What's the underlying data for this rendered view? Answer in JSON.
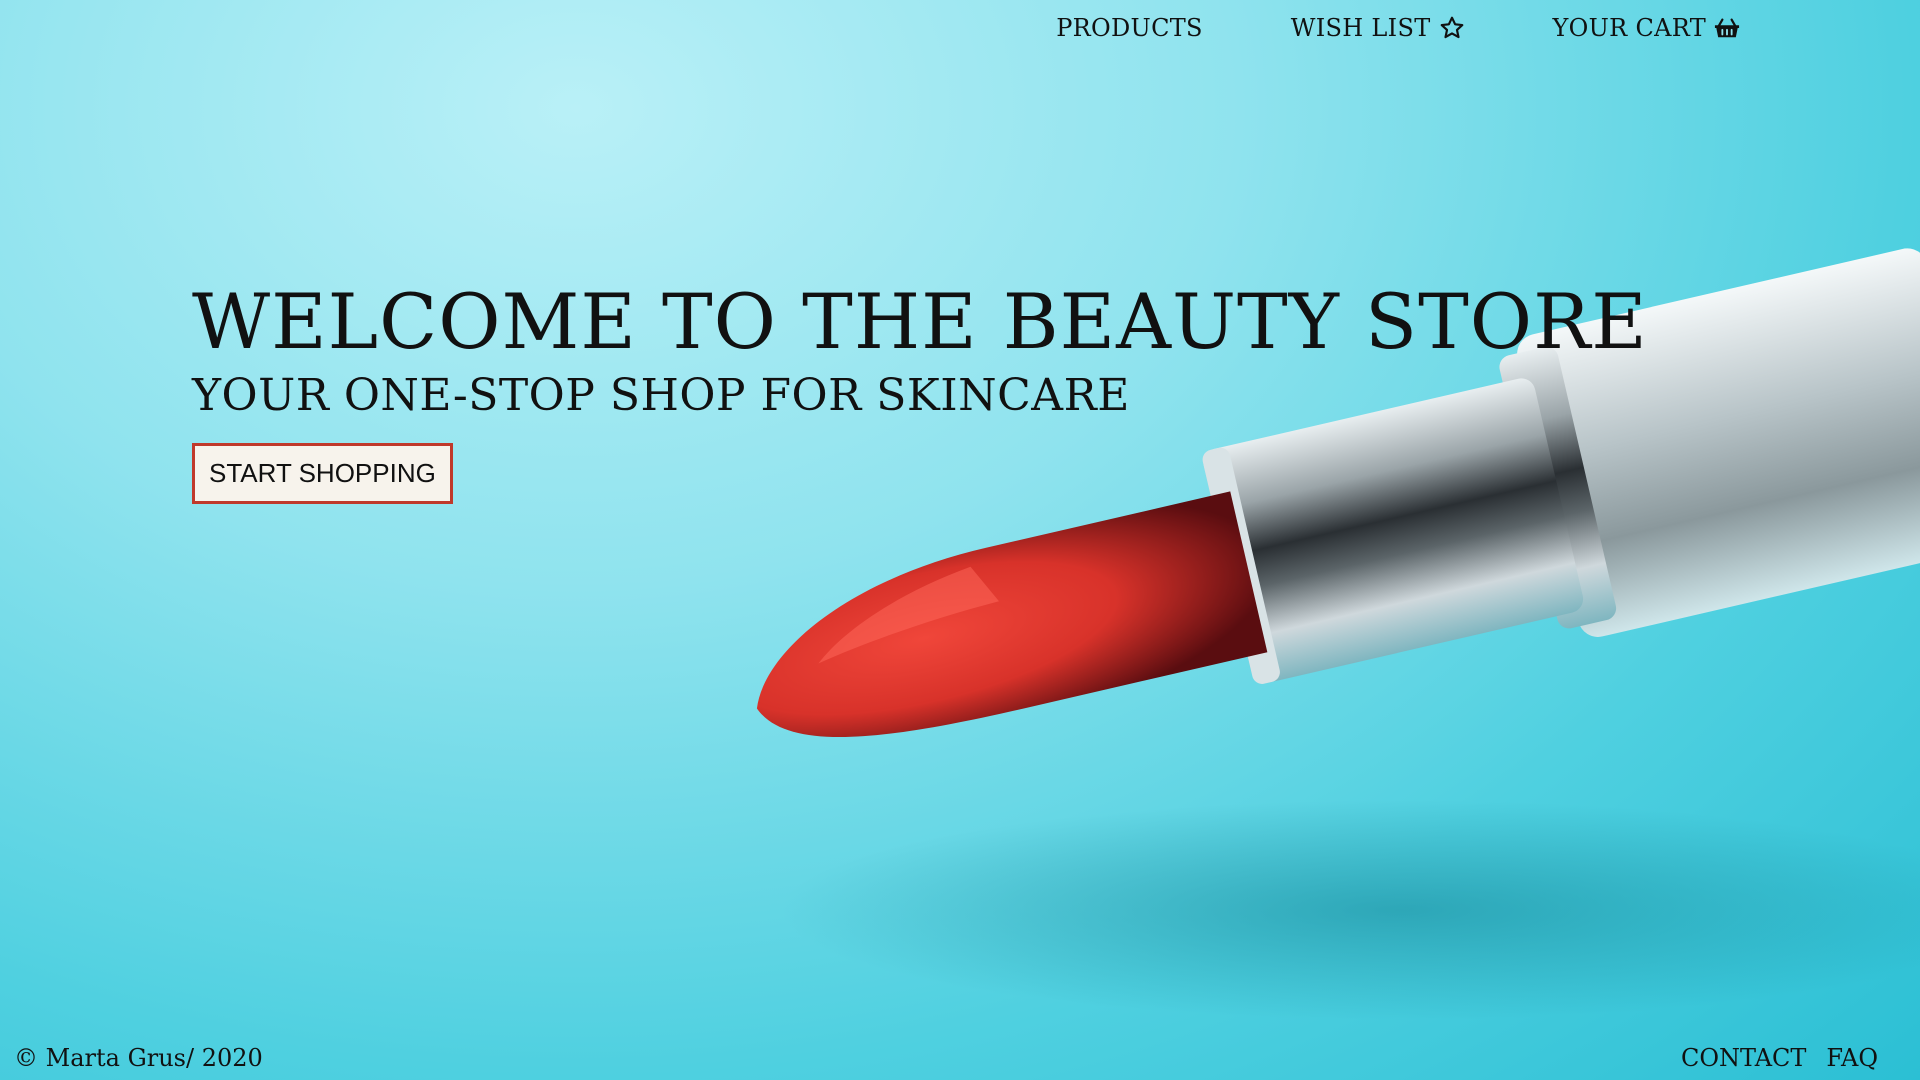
{
  "nav": {
    "products": "PRODUCTS",
    "wishlist": "WISH LIST",
    "cart": "YOUR CART"
  },
  "hero": {
    "title": "WELCOME TO THE BEAUTY STORE",
    "subtitle": "YOUR ONE-STOP SHOP FOR SKINCARE",
    "cta": "START SHOPPING"
  },
  "footer": {
    "copyright": "© Marta Grus/ 2020",
    "contact": "CONTACT",
    "faq": "FAQ"
  },
  "colors": {
    "background": "#4fd0e0",
    "cta_border": "#c0392b",
    "cta_background": "#f7f3ec",
    "lipstick_red": "#d8322a"
  },
  "icons": {
    "wishlist": "star-outline-icon",
    "cart": "basket-icon"
  }
}
